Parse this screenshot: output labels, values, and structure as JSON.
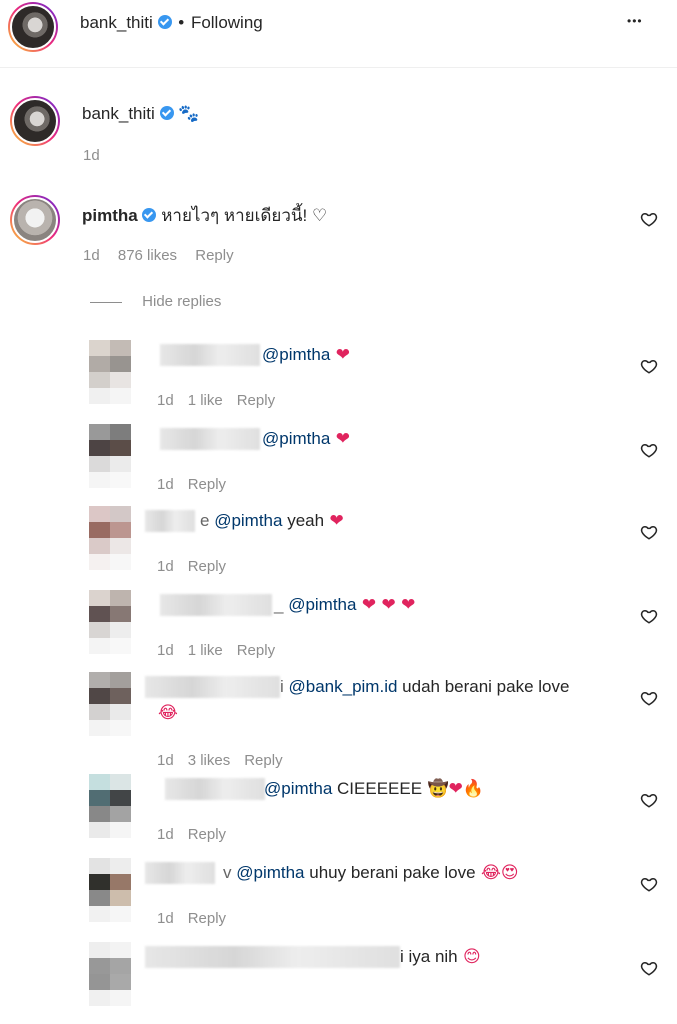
{
  "header": {
    "username": "bank_thiti",
    "separator": "•",
    "following": "Following",
    "more": "•••"
  },
  "caption": {
    "username": "bank_thiti",
    "emoji": "🐾",
    "time": "1d"
  },
  "comment": {
    "username": "pimtha",
    "text": "หายไวๆ หายเดียวนี้!",
    "time": "1d",
    "likes": "876 likes",
    "reply": "Reply",
    "hide_replies": "Hide replies"
  },
  "replies": [
    {
      "prefix": "",
      "mention": "@pimtha",
      "text": "",
      "emojis": "❤",
      "time": "1d",
      "likes": "1 like",
      "reply": "Reply"
    },
    {
      "prefix": "",
      "mention": "@pimtha",
      "text": "",
      "emojis": "❤",
      "time": "1d",
      "likes": "",
      "reply": "Reply"
    },
    {
      "prefix": "e",
      "mention": "@pimtha",
      "text": " yeah",
      "emojis": "❤",
      "time": "1d",
      "likes": "",
      "reply": "Reply"
    },
    {
      "prefix": "_",
      "mention": "@pimtha",
      "text": "",
      "emojis": "❤ ❤ ❤",
      "time": "1d",
      "likes": "1 like",
      "reply": "Reply"
    },
    {
      "prefix": "i",
      "mention": "@bank_pim.id",
      "text": " udah berani pake love",
      "emojis": "😂",
      "time": "1d",
      "likes": "3 likes",
      "reply": "Reply"
    },
    {
      "prefix": "",
      "mention": "@pimtha",
      "text": " CIEEEEEE",
      "emojis": "🤠❤🔥",
      "time": "1d",
      "likes": "",
      "reply": "Reply"
    },
    {
      "prefix": "v",
      "mention": "@pimtha",
      "text": " uhuy berani pake love",
      "emojis": "😂😍",
      "time": "1d",
      "likes": "",
      "reply": "Reply"
    },
    {
      "prefix": "",
      "mention": "",
      "text": "i iya nih",
      "emojis": "😊",
      "time": "",
      "likes": "",
      "reply": ""
    }
  ],
  "colors": {
    "verified": "#3897f0",
    "mention": "#00376b",
    "heart": "#e0245e"
  }
}
